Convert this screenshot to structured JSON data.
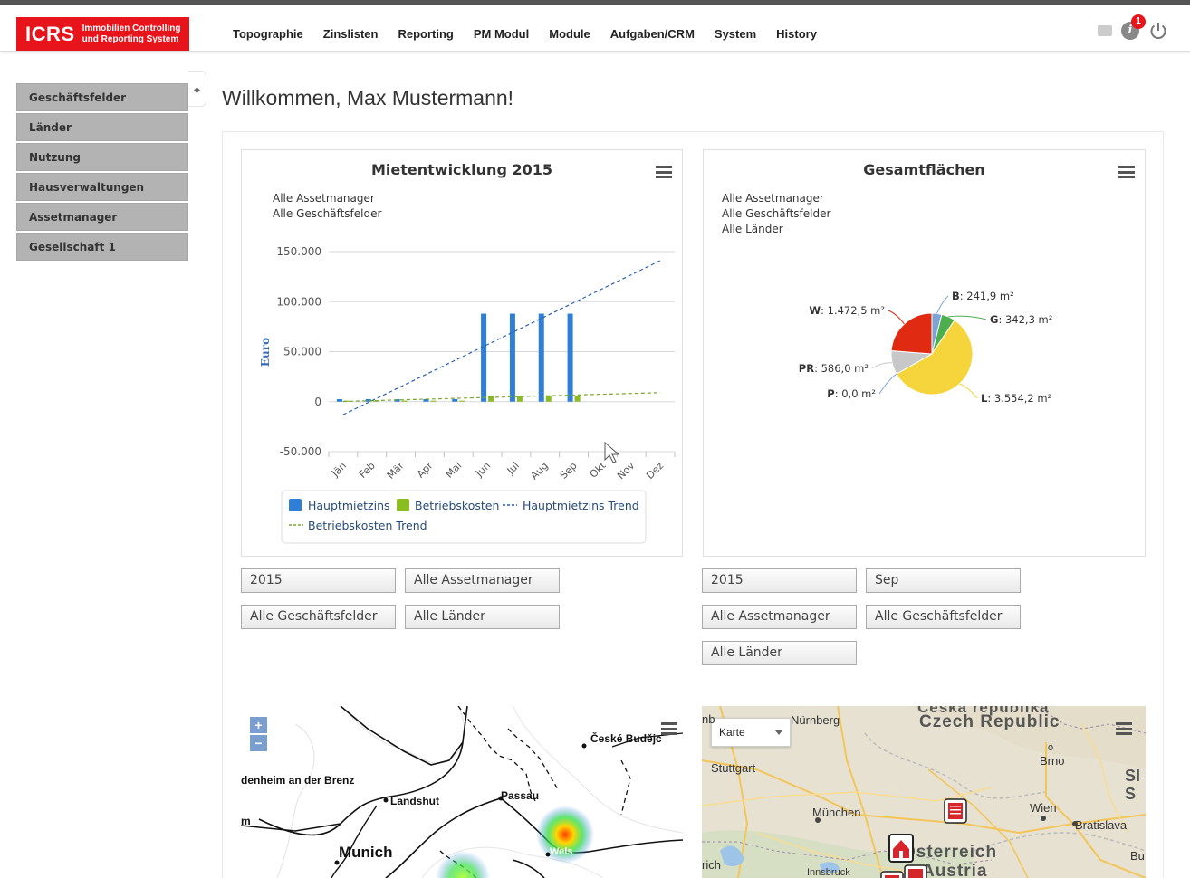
{
  "brand": {
    "short": "ICRS",
    "line1": "Immobilien Controlling",
    "line2": "und Reporting System"
  },
  "nav": [
    "Topographie",
    "Zinslisten",
    "Reporting",
    "PM Modul",
    "Module",
    "Aufgaben/CRM",
    "System",
    "History"
  ],
  "notifications": {
    "count": "1"
  },
  "sidebar": {
    "items": [
      {
        "label": "Geschäftsfelder"
      },
      {
        "label": "Länder"
      },
      {
        "label": "Nutzung"
      },
      {
        "label": "Hausverwaltungen"
      },
      {
        "label": "Assetmanager"
      },
      {
        "label": "Gesellschaft 1"
      }
    ]
  },
  "welcome": "Willkommen, Max Mustermann!",
  "chart1": {
    "title": "Mietentwicklung 2015",
    "subtitle": [
      "Alle Assetmanager",
      "Alle Geschäftsfelder"
    ],
    "ylabel": "Euro",
    "yticks": [
      "150.000",
      "100.000",
      "50.000",
      "0",
      "-50.000"
    ],
    "legend": [
      "Hauptmietzins",
      "Betriebskosten",
      "Hauptmietzins Trend",
      "Betriebskosten Trend"
    ]
  },
  "chart2": {
    "title": "Gesamtflächen",
    "subtitle": [
      "Alle Assetmanager",
      "Alle Geschäftsfelder",
      "Alle Länder"
    ]
  },
  "filters1": [
    "2015",
    "Alle Assetmanager",
    "Alle Geschäftsfelder",
    "Alle Länder"
  ],
  "filters2": [
    "2015",
    "Sep",
    "Alle Assetmanager",
    "Alle Geschäftsfelder",
    "Alle Länder"
  ],
  "map1": {
    "labels": [
      "České Budějc",
      "denheim an der Brenz",
      "Passau",
      "Landshut",
      "m",
      "Munich",
      "Wels"
    ]
  },
  "map2": {
    "control": "Karte",
    "labels": [
      "Nürnberg",
      "Česká republika",
      "Czech Republic",
      "Brno",
      "Stuttgart",
      "SI",
      "S",
      "München",
      "Wien",
      "Bratislava",
      "Österreich",
      "Austria",
      "rich",
      "Innsbruck",
      "nb",
      "Bu",
      "o"
    ]
  },
  "colors": {
    "accent": "#e8141b",
    "hauptmietzins": "#2f7ed8",
    "betriebskosten": "#8bbc21",
    "trend_haupt": "#2b5fb0",
    "trend_betrieb": "#7aa830"
  },
  "chart_data": [
    {
      "type": "bar",
      "title": "Mietentwicklung 2015",
      "ylabel": "Euro",
      "ylim": [
        -50000,
        150000
      ],
      "categories": [
        "Jän",
        "Feb",
        "Mär",
        "Apr",
        "Mai",
        "Jun",
        "Jul",
        "Aug",
        "Sep",
        "Okt",
        "Nov",
        "Dez"
      ],
      "series": [
        {
          "name": "Hauptmietzins",
          "type": "bar",
          "values": [
            2500,
            2500,
            2500,
            2500,
            2500,
            88000,
            88000,
            88000,
            88000,
            0,
            0,
            0
          ]
        },
        {
          "name": "Betriebskosten",
          "type": "bar",
          "values": [
            1000,
            1000,
            1000,
            1000,
            1000,
            6000,
            6000,
            6000,
            6000,
            0,
            0,
            0
          ]
        },
        {
          "name": "Hauptmietzins Trend",
          "type": "line",
          "values": [
            -13000,
            1000,
            15000,
            29000,
            43000,
            57000,
            71000,
            85000,
            99000,
            113000,
            127000,
            141000
          ]
        },
        {
          "name": "Betriebskosten Trend",
          "type": "line",
          "values": [
            200,
            1000,
            1800,
            2600,
            3400,
            4200,
            5000,
            5800,
            6600,
            7400,
            8200,
            9000
          ]
        }
      ]
    },
    {
      "type": "pie",
      "title": "Gesamtflächen",
      "unit": "m²",
      "slices": [
        {
          "label": "B",
          "value": 241.9,
          "display": "241,9 m²",
          "color": "#7ba3d6"
        },
        {
          "label": "G",
          "value": 342.3,
          "display": "342,3 m²",
          "color": "#4cae4c"
        },
        {
          "label": "L",
          "value": 3554.2,
          "display": "3.554,2 m²",
          "color": "#f5d53b"
        },
        {
          "label": "P",
          "value": 0.0,
          "display": "0,0 m²",
          "color": "#7ba3d6"
        },
        {
          "label": "PR",
          "value": 586.0,
          "display": "586,0 m²",
          "color": "#c8c8c8"
        },
        {
          "label": "W",
          "value": 1472.5,
          "display": "1.472,5 m²",
          "color": "#e02a12"
        }
      ]
    }
  ]
}
